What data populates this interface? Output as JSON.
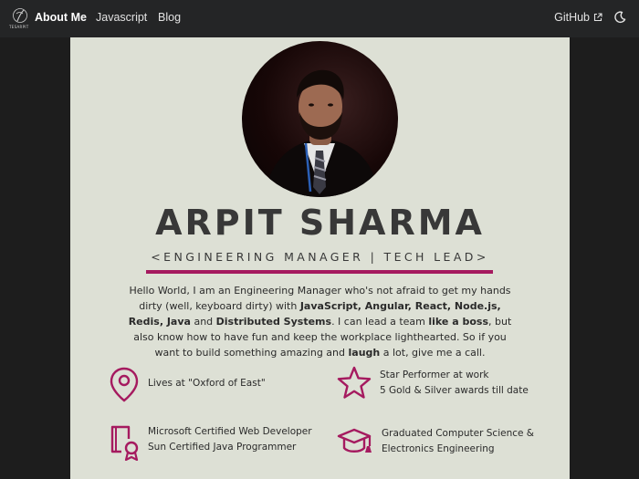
{
  "nav": {
    "logo_text": "TESARPIT",
    "links": [
      "About Me",
      "Javascript",
      "Blog"
    ],
    "github_label": "GitHub"
  },
  "profile": {
    "name": "ARPIT SHARMA",
    "role": "<ENGINEERING MANAGER | TECH LEAD>",
    "bio": [
      {
        "t": "Hello World, I am an Engineering Manager who's not afraid to get my hands dirty (well, keyboard dirty) with ",
        "b": false
      },
      {
        "t": "JavaScript, Angular, React, Node.js, Redis, Java",
        "b": true
      },
      {
        "t": " and ",
        "b": false
      },
      {
        "t": "Distributed Systems",
        "b": true
      },
      {
        "t": ". I can lead a team ",
        "b": false
      },
      {
        "t": "like a boss",
        "b": true
      },
      {
        "t": ", but also know how to have fun and keep the workplace lighthearted. So if you want to build something amazing and ",
        "b": false
      },
      {
        "t": "laugh",
        "b": true
      },
      {
        "t": " a lot, give me a call.",
        "b": false
      }
    ]
  },
  "features": [
    {
      "icon": "location-pin-icon",
      "lines": [
        "Lives at  \"Oxford of East\""
      ]
    },
    {
      "icon": "star-icon",
      "lines": [
        "Star Performer at work",
        "5 Gold & Silver awards till date"
      ]
    },
    {
      "icon": "certificate-icon",
      "lines": [
        "Microsoft Certified Web Developer",
        "Sun Certified Java Programmer"
      ]
    },
    {
      "icon": "graduation-cap-icon",
      "lines": [
        "Graduated Computer Science &",
        "Electronics Engineering"
      ]
    }
  ],
  "colors": {
    "navbar": "#242526",
    "page_bg": "#1d1d1d",
    "card_bg": "#dde0d5",
    "accent": "#a51a5f",
    "text": "#383838"
  }
}
